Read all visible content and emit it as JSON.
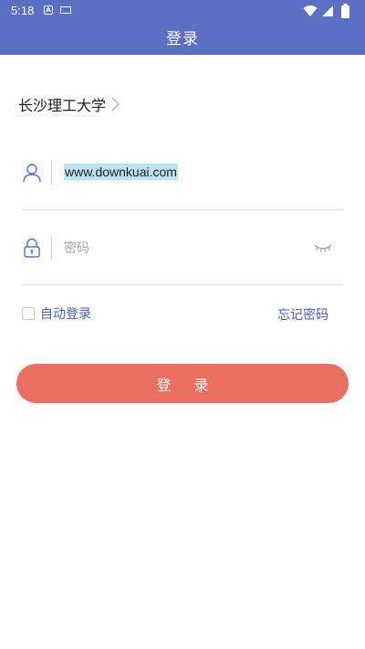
{
  "status_bar": {
    "time": "5:18",
    "icons": [
      "a-notification-icon",
      "keyboard-icon",
      "wifi-icon",
      "signal-icon",
      "battery-icon"
    ]
  },
  "header": {
    "title": "登录"
  },
  "school": {
    "name": "长沙理工大学",
    "icon": "chevron-right-icon"
  },
  "form": {
    "username": {
      "value": "www.downkuai.com",
      "icon": "user-icon"
    },
    "password": {
      "placeholder": "密码",
      "value": "",
      "icon": "lock-icon",
      "toggle_icon": "eye-closed-icon"
    },
    "auto_login": {
      "label": "自动登录",
      "checked": false
    },
    "forgot_label": "忘记密码",
    "login_label": "登 录"
  },
  "colors": {
    "app_bar": "#5b6fc5",
    "accent_text": "#4a5fb8",
    "login_button": "#eb6f61",
    "selection_highlight": "#b8e4f2"
  }
}
